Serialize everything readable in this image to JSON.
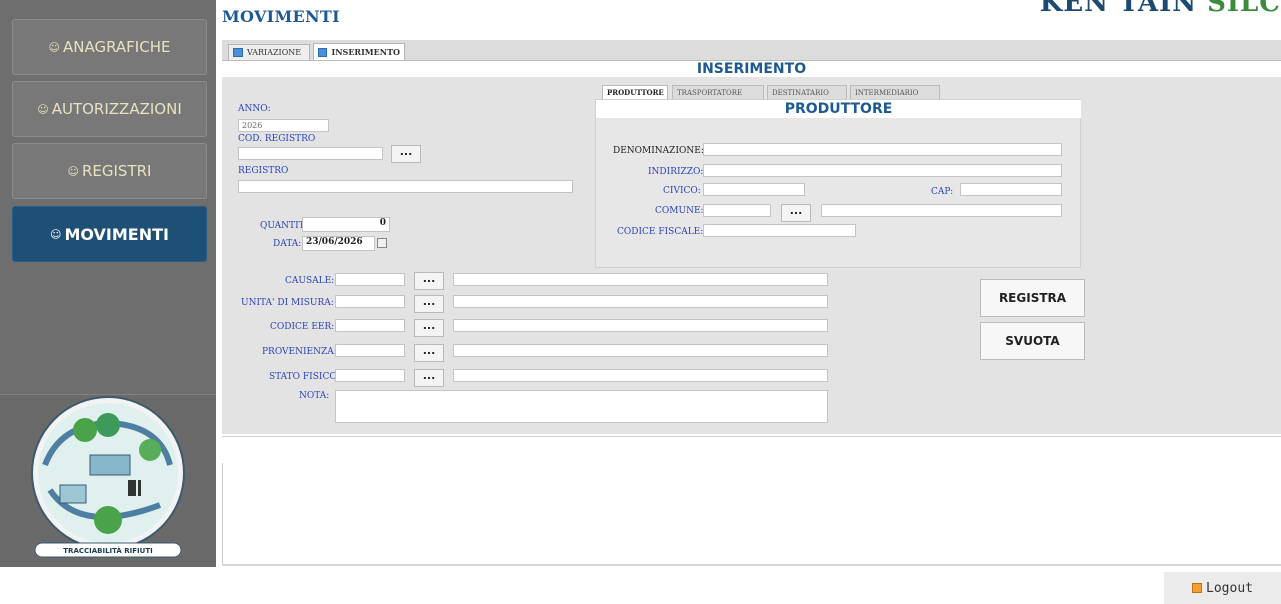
{
  "brand": {
    "prefix": "KEN TAIN",
    "suffix": "SILC"
  },
  "sidebar": {
    "items": [
      {
        "label": "ANAGRAFICHE"
      },
      {
        "label": "AUTORIZZAZIONI"
      },
      {
        "label": "REGISTRI"
      },
      {
        "label": "MOVIMENTI",
        "active": true
      }
    ],
    "logo_caption": "TRACCIABILITÀ RIFIUTI"
  },
  "page_title": "MOVIMENTI",
  "tabs": [
    {
      "label": "VARIAZIONE"
    },
    {
      "label": "INSERIMENTO",
      "active": true
    }
  ],
  "section_title": "INSERIMENTO",
  "left_form": {
    "anno_label": "ANNO:",
    "anno_value": "2026",
    "cod_registro_label": "COD. REGISTRO",
    "registro_label": "REGISTRO",
    "quantita_label": "QUANTITA':",
    "quantita_value": "0",
    "data_label": "DATA:",
    "data_value": "23/06/2026"
  },
  "inner_tabs": [
    {
      "label": "PRODUTTORE",
      "active": true
    },
    {
      "label": "TRASPORTATORE"
    },
    {
      "label": "DESTINATARIO"
    },
    {
      "label": "INTERMEDIARIO"
    }
  ],
  "produttore": {
    "title": "PRODUTTORE",
    "denominazione_label": "DENOMINAZIONE:",
    "indirizzo_label": "INDIRIZZO:",
    "civico_label": "CIVICO:",
    "cap_label": "CAP:",
    "comune_label": "COMUNE:",
    "codice_fiscale_label": "CODICE FISCALE:"
  },
  "lower_form": {
    "causale_label": "CAUSALE:",
    "unita_label": "UNITA' DI MISURA:",
    "codice_eer_label": "CODICE EER:",
    "provenienza_label": "PROVENIENZA:",
    "stato_fisico_label": "STATO FISICO:",
    "nota_label": "NOTA:"
  },
  "buttons": {
    "dots": "...",
    "registra": "REGISTRA",
    "svuota": "SVUOTA",
    "logout": "Logout"
  },
  "colors": {
    "accent": "#1d5a91",
    "sidebar_bg": "#6e6e6e",
    "active_nav": "#1e4f74",
    "label_blue": "#2b46b8"
  }
}
